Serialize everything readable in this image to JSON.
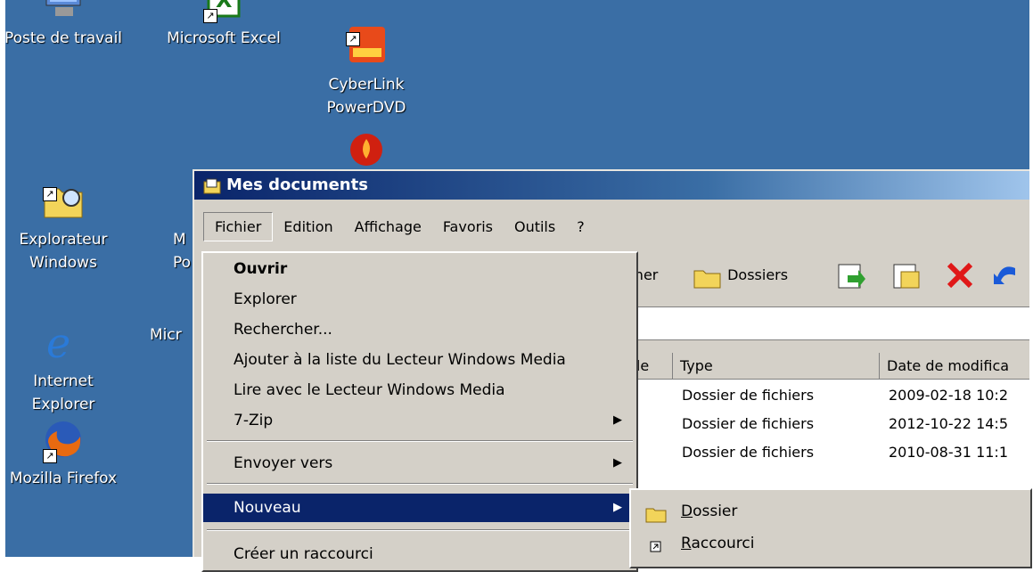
{
  "desktop": {
    "icons": [
      {
        "label": "Poste de travail"
      },
      {
        "label": "Microsoft Excel"
      },
      {
        "label": "CyberLink\nPowerDVD"
      },
      {
        "label": "Explorateur\nWindows"
      },
      {
        "label": "M\nPo"
      },
      {
        "label": "Internet\nExplorer"
      },
      {
        "label": "Micr"
      },
      {
        "label": "Mozilla Firefox"
      }
    ]
  },
  "window": {
    "title": "Mes documents",
    "menu": [
      "Fichier",
      "Edition",
      "Affichage",
      "Favoris",
      "Outils",
      "?"
    ],
    "toolbar": {
      "search_partial": "cher",
      "folders": "Dossiers"
    },
    "columns": {
      "size_partial": "ille",
      "type": "Type",
      "date": "Date de modifica"
    },
    "rows": [
      {
        "type": "Dossier de fichiers",
        "date": "2009-02-18 10:2"
      },
      {
        "type": "Dossier de fichiers",
        "date": "2012-10-22 14:5"
      },
      {
        "type": "Dossier de fichiers",
        "date": "2010-08-31 11:1"
      }
    ]
  },
  "fichier_menu": {
    "items": [
      {
        "label": "Ouvrir"
      },
      {
        "label": "Explorer"
      },
      {
        "label": "Rechercher..."
      },
      {
        "label": "Ajouter à la liste du Lecteur Windows Media"
      },
      {
        "label": "Lire avec le Lecteur Windows Media"
      },
      {
        "label": "7-Zip"
      },
      {
        "label": "Envoyer vers"
      },
      {
        "label": "Nouveau"
      },
      {
        "label": "Créer un raccourci"
      }
    ]
  },
  "nouveau_menu": {
    "items": [
      {
        "label_first": "D",
        "label_rest": "ossier"
      },
      {
        "label_first": "R",
        "label_rest": "accourci"
      }
    ]
  },
  "colors": {
    "desktop": "#3a6ea5",
    "highlight": "#0a246a",
    "face": "#d4d0c8"
  }
}
